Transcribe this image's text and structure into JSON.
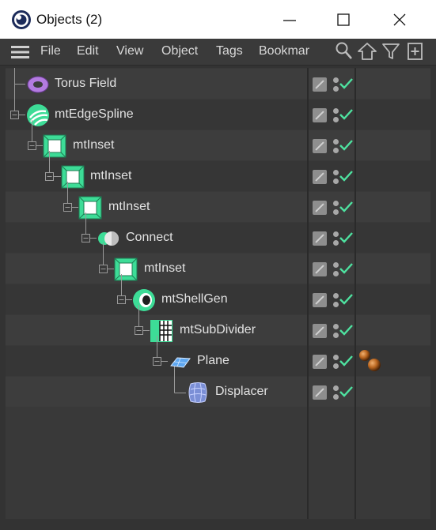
{
  "window": {
    "title": "Objects (2)"
  },
  "menu": {
    "items": [
      "File",
      "Edit",
      "View",
      "Object",
      "Tags",
      "Bookmar"
    ]
  },
  "tree": {
    "rows": [
      {
        "name": "Torus Field",
        "icon": "torus-field-icon"
      },
      {
        "name": "mtEdgeSpline",
        "icon": "spline-icon"
      },
      {
        "name": "mtInset",
        "icon": "inset-icon"
      },
      {
        "name": "mtInset",
        "icon": "inset-icon"
      },
      {
        "name": "mtInset",
        "icon": "inset-icon"
      },
      {
        "name": "Connect",
        "icon": "connect-icon"
      },
      {
        "name": "mtInset",
        "icon": "inset-icon"
      },
      {
        "name": "mtShellGen",
        "icon": "shellgen-icon"
      },
      {
        "name": "mtSubDivider",
        "icon": "subdivider-icon"
      },
      {
        "name": "Plane",
        "icon": "plane-icon",
        "tag": "material-tag-icon"
      },
      {
        "name": "Displacer",
        "icon": "displacer-icon"
      }
    ]
  },
  "colors": {
    "accent_green": "#3ddc97",
    "check_green": "#4ee2a0",
    "window_bg": "#333333"
  }
}
